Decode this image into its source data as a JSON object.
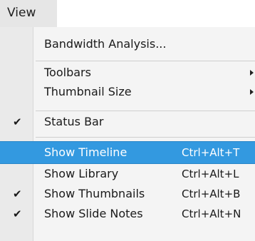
{
  "menubar": {
    "label": "View"
  },
  "menu": {
    "items": [
      {
        "label": "Bandwidth Analysis..."
      },
      {
        "label": "Toolbars",
        "submenu": true
      },
      {
        "label": "Thumbnail Size",
        "submenu": true
      },
      {
        "label": "Status Bar",
        "checked": true
      },
      {
        "label": "Show Timeline",
        "shortcut": "Ctrl+Alt+T",
        "highlighted": true
      },
      {
        "label": "Show Library",
        "shortcut": "Ctrl+Alt+L"
      },
      {
        "label": "Show Thumbnails",
        "shortcut": "Ctrl+Alt+B",
        "checked": true
      },
      {
        "label": "Show Slide Notes",
        "shortcut": "Ctrl+Alt+N",
        "checked": true
      }
    ],
    "check_glyph": "✔",
    "highlight_color": "#3399e0"
  }
}
